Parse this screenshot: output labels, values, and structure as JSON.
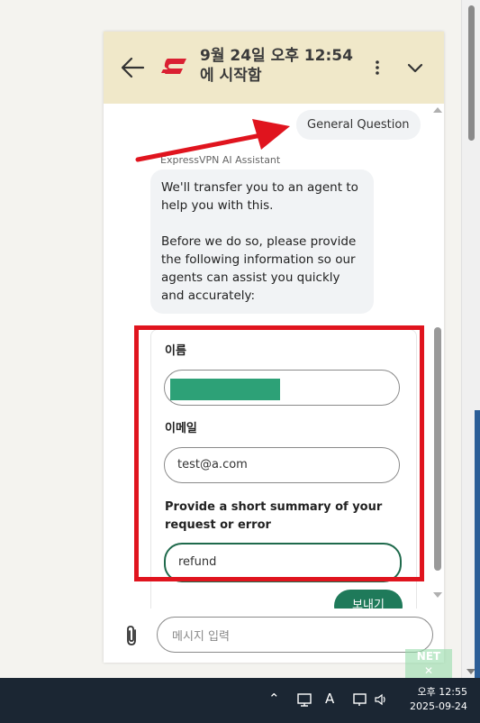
{
  "header": {
    "title": "9월 24일 오후 12:54 에 시작함"
  },
  "chat": {
    "user_message": "General Question",
    "sender_name": "ExpressVPN AI Assistant",
    "bot_paragraph_1": "We'll transfer you to an agent to help you with this.",
    "bot_paragraph_2": "Before we do so, please provide the following information so our agents can assist you quickly and accurately:"
  },
  "form": {
    "name_label": "이름",
    "email_label": "이메일",
    "email_value": "test@a.com",
    "summary_label": "Provide a short summary of your request or error",
    "summary_value": "refund",
    "submit_label": "보내기"
  },
  "composer": {
    "placeholder": "메시지 입력"
  },
  "taskbar": {
    "time": "오후 12:55",
    "date": "2025-09-24",
    "ime_label": "A"
  },
  "colors": {
    "header_bg": "#f0e8c9",
    "brand_red": "#da2032",
    "accent_green": "#1f7a5a",
    "highlight_red": "#e0141e"
  }
}
